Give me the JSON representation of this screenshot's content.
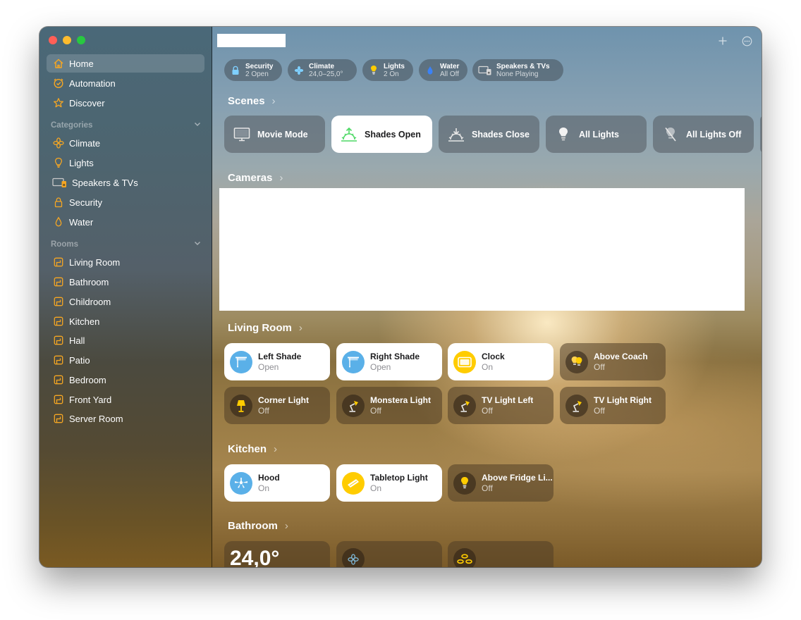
{
  "window": {
    "buttons": [
      "close",
      "minimize",
      "zoom"
    ]
  },
  "sidebar": {
    "nav": [
      {
        "label": "Home",
        "icon": "house-icon",
        "selected": true
      },
      {
        "label": "Automation",
        "icon": "clock-check-icon",
        "selected": false
      },
      {
        "label": "Discover",
        "icon": "star-icon",
        "selected": false
      }
    ],
    "categories_header": "Categories",
    "categories": [
      {
        "label": "Climate",
        "icon": "fan-icon"
      },
      {
        "label": "Lights",
        "icon": "lightbulb-icon"
      },
      {
        "label": "Speakers & TVs",
        "icon": "tv-speaker-icon"
      },
      {
        "label": "Security",
        "icon": "lock-icon"
      },
      {
        "label": "Water",
        "icon": "drop-icon"
      }
    ],
    "rooms_header": "Rooms",
    "rooms": [
      {
        "label": "Living Room",
        "icon": "room-icon"
      },
      {
        "label": "Bathroom",
        "icon": "room-icon"
      },
      {
        "label": "Childroom",
        "icon": "room-icon"
      },
      {
        "label": "Kitchen",
        "icon": "room-icon"
      },
      {
        "label": "Hall",
        "icon": "room-icon"
      },
      {
        "label": "Patio",
        "icon": "room-icon"
      },
      {
        "label": "Bedroom",
        "icon": "room-icon"
      },
      {
        "label": "Front Yard",
        "icon": "room-icon"
      },
      {
        "label": "Server Room",
        "icon": "room-icon"
      }
    ]
  },
  "toolbar": {
    "add_icon": "plus-icon",
    "more_icon": "ellipsis-circle-icon"
  },
  "status_chips": [
    {
      "title": "Security",
      "subtitle": "2 Open",
      "icon": "lock-icon"
    },
    {
      "title": "Climate",
      "subtitle": "24,0–25,0°",
      "icon": "fan-icon"
    },
    {
      "title": "Lights",
      "subtitle": "2 On",
      "icon": "lightbulb-icon"
    },
    {
      "title": "Water",
      "subtitle": "All Off",
      "icon": "drop-icon"
    },
    {
      "title": "Speakers & TVs",
      "subtitle": "None Playing",
      "icon": "tv-speaker-icon"
    }
  ],
  "scenes": {
    "title": "Scenes",
    "items": [
      {
        "label": "Movie Mode",
        "icon": "monitor-icon",
        "active": false
      },
      {
        "label": "Shades Open",
        "icon": "sunrise-icon",
        "active": true
      },
      {
        "label": "Shades Close",
        "icon": "sunset-icon",
        "active": false
      },
      {
        "label": "All Lights",
        "icon": "lightbulb-icon",
        "active": false
      },
      {
        "label": "All Lights Off",
        "icon": "lightbulb-slash-icon",
        "active": false
      }
    ]
  },
  "cameras": {
    "title": "Cameras"
  },
  "living_room": {
    "title": "Living Room",
    "tiles": [
      {
        "name": "Left Shade",
        "status": "Open",
        "icon": "shade-icon",
        "on": true
      },
      {
        "name": "Right Shade",
        "status": "Open",
        "icon": "shade-icon",
        "on": true
      },
      {
        "name": "Clock",
        "status": "On",
        "icon": "clock-display-icon",
        "on": true
      },
      {
        "name": "Above Coach",
        "status": "Off",
        "icon": "double-bulb-icon",
        "on": false
      },
      {
        "name": "Corner Light",
        "status": "Off",
        "icon": "floor-lamp-icon",
        "on": false
      },
      {
        "name": "Monstera Light",
        "status": "Off",
        "icon": "desk-lamp-icon",
        "on": false
      },
      {
        "name": "TV Light Left",
        "status": "Off",
        "icon": "desk-lamp-icon",
        "on": false
      },
      {
        "name": "TV Light Right",
        "status": "Off",
        "icon": "desk-lamp-icon",
        "on": false
      }
    ]
  },
  "kitchen": {
    "title": "Kitchen",
    "tiles": [
      {
        "name": "Hood",
        "status": "On",
        "icon": "ceiling-fan-icon",
        "on": true
      },
      {
        "name": "Tabletop Light",
        "status": "On",
        "icon": "light-strip-icon",
        "on": true
      },
      {
        "name": "Above Fridge Li...",
        "status": "Off",
        "icon": "lightbulb-icon",
        "on": false
      }
    ]
  },
  "bathroom": {
    "title": "Bathroom",
    "temperature": "24,0°",
    "tiles": [
      {
        "icon": "fan-icon"
      },
      {
        "icon": "recessed-lights-icon"
      }
    ]
  },
  "colors": {
    "accent": "#f5a623",
    "bulb_yellow": "#ffcc00",
    "shade_blue": "#5ab0e8"
  }
}
